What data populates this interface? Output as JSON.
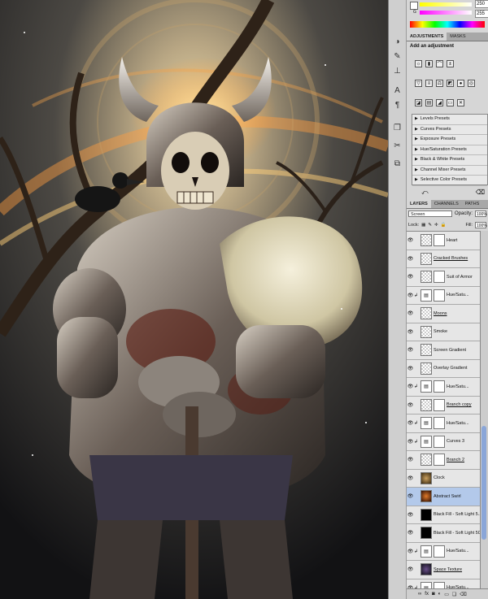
{
  "color": {
    "values": [
      "250",
      "255"
    ]
  },
  "adjustments": {
    "tabs": [
      "ADJUSTMENTS",
      "MASKS"
    ],
    "title": "Add an adjustment",
    "presets": [
      "Levels Presets",
      "Curves Presets",
      "Exposure Presets",
      "Hue/Saturation Presets",
      "Black & White Presets",
      "Channel Mixer Presets",
      "Selective Color Presets"
    ]
  },
  "layers_panel": {
    "tabs": [
      "LAYERS",
      "CHANNELS",
      "PATHS"
    ],
    "blend_mode": "Screen",
    "opacity_label": "Opacity:",
    "opacity": "100%",
    "lock_label": "Lock:",
    "fill_label": "Fill:",
    "fill": "100%",
    "layers": [
      {
        "name": "Heart",
        "type": "masked",
        "underline": false,
        "selected": false
      },
      {
        "name": "Cracked Brushes",
        "type": "checker",
        "underline": true,
        "selected": false
      },
      {
        "name": "Suit of Armor",
        "type": "masked",
        "underline": false,
        "selected": false
      },
      {
        "name": "Hue/Satu...",
        "type": "adj",
        "underline": false,
        "selected": false
      },
      {
        "name": "Moons",
        "type": "checker",
        "underline": true,
        "selected": false
      },
      {
        "name": "Smoke",
        "type": "checker",
        "underline": false,
        "selected": false
      },
      {
        "name": "Screen Gradient",
        "type": "checker",
        "underline": false,
        "selected": false
      },
      {
        "name": "Overlay Gradient",
        "type": "checker",
        "underline": false,
        "selected": false
      },
      {
        "name": "Hue/Satu...",
        "type": "adj",
        "underline": false,
        "selected": false
      },
      {
        "name": "Branch copy",
        "type": "masked",
        "underline": true,
        "selected": false
      },
      {
        "name": "Hue/Satu...",
        "type": "adj",
        "underline": false,
        "selected": false
      },
      {
        "name": "Curves 3",
        "type": "adj",
        "underline": false,
        "selected": false
      },
      {
        "name": "Branch 2",
        "type": "masked",
        "underline": true,
        "selected": false
      },
      {
        "name": "Clock",
        "type": "clock",
        "underline": false,
        "selected": false
      },
      {
        "name": "Abstract Swirl",
        "type": "swirl",
        "underline": false,
        "selected": true
      },
      {
        "name": "Black Fill - Soft Light 5...",
        "type": "black",
        "underline": false,
        "selected": false
      },
      {
        "name": "Black Fill - Soft Light 50%",
        "type": "black",
        "underline": false,
        "selected": false
      },
      {
        "name": "Hue/Satu...",
        "type": "adj",
        "underline": false,
        "selected": false
      },
      {
        "name": "Space Texture",
        "type": "space",
        "underline": true,
        "selected": false
      },
      {
        "name": "Hue/Satu...",
        "type": "adj",
        "underline": false,
        "selected": false
      }
    ]
  }
}
